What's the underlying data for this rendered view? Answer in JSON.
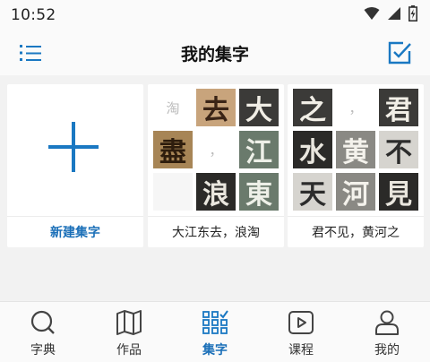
{
  "status_bar": {
    "time": "10:52"
  },
  "header": {
    "title": "我的集字",
    "menu_icon": "list-icon",
    "action_icon": "edit-check-icon"
  },
  "accent_color": "#1a78c2",
  "cards": [
    {
      "label": "新建集字",
      "type": "new"
    },
    {
      "label": "大江东去，浪淘",
      "tiles": [
        "淘",
        "去",
        "大",
        "盡",
        "，",
        "江",
        "",
        "浪",
        "東"
      ]
    },
    {
      "label": "君不见，黄河之",
      "tiles": [
        "之",
        "，",
        "君",
        "水",
        "黄",
        "不",
        "天",
        "河",
        "見"
      ]
    }
  ],
  "bottom_nav": [
    {
      "label": "字典",
      "icon": "search-icon"
    },
    {
      "label": "作品",
      "icon": "map-icon"
    },
    {
      "label": "集字",
      "icon": "grid-icon",
      "active": true
    },
    {
      "label": "课程",
      "icon": "video-icon"
    },
    {
      "label": "我的",
      "icon": "user-icon"
    }
  ]
}
